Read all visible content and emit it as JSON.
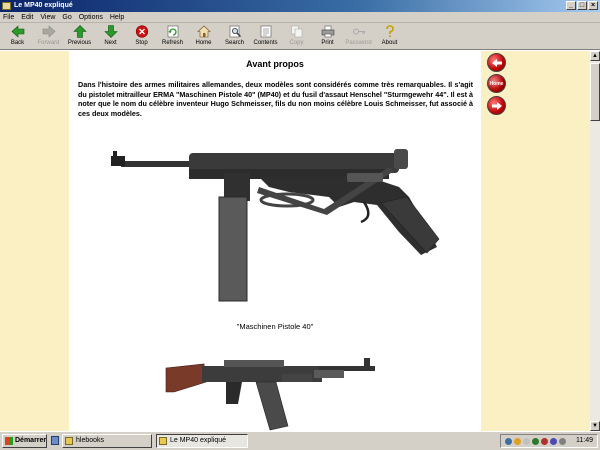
{
  "window": {
    "title": "Le MP40 expliqué",
    "minimize": "_",
    "maximize": "□",
    "close": "×"
  },
  "menu": [
    "File",
    "Edit",
    "View",
    "Go",
    "Options",
    "Help"
  ],
  "toolbar": {
    "back": "Back",
    "forward": "Forward",
    "previous": "Previous",
    "next": "Next",
    "stop": "Stop",
    "refresh": "Refresh",
    "home": "Home",
    "search": "Search",
    "contents": "Contents",
    "copy": "Copy",
    "print": "Print",
    "password": "Password",
    "about": "About"
  },
  "page": {
    "title": "Avant propos",
    "paragraph": "Dans l'histoire des armes militaires allemandes, deux modèles sont considérés comme très remarquables. Il s'agit du pistolet mitrailleur ERMA \"Maschinen Pistole 40\" (MP40) et du fusil d'assaut Henschel \"Sturmgewehr 44\". Il est à noter que le nom du célèbre inventeur Hugo Schmeisser, fils du non moins célèbre Louis Schmeisser, fut associé à ces deux modèles.",
    "caption": "\"Maschinen Pistole 40\""
  },
  "nav": {
    "home_label": "Home"
  },
  "taskbar": {
    "start": "Démarrer",
    "tasks": [
      "hlebooks",
      "Le MP40 expliqué"
    ],
    "clock": "11:49"
  },
  "colors": {
    "side_band": "#fbf0c4",
    "titlebar": "#0a246a"
  }
}
